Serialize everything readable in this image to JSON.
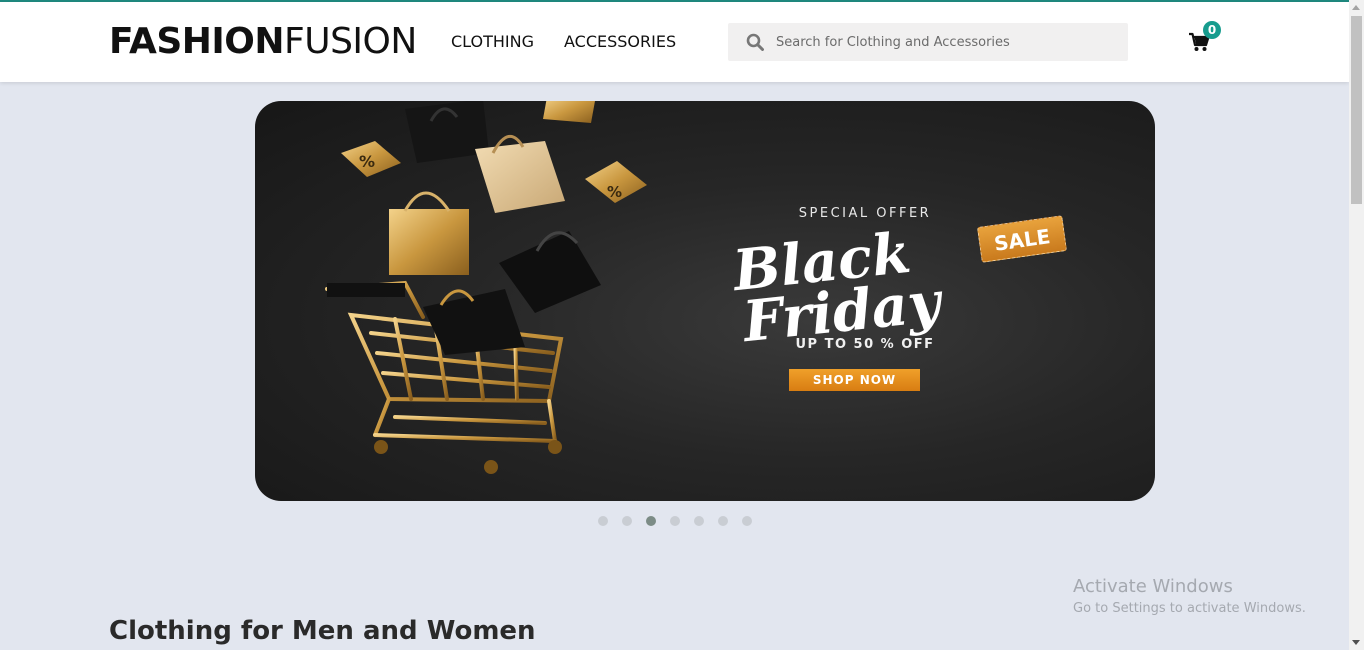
{
  "header": {
    "logo_bold": "FASHION",
    "logo_light": "FUSION",
    "nav": [
      {
        "label": "CLOTHING"
      },
      {
        "label": "ACCESSORIES"
      }
    ],
    "search_placeholder": "Search for Clothing and Accessories",
    "search_icon": "search-icon",
    "cart_icon": "cart-icon",
    "cart_count": "0"
  },
  "banner": {
    "special_offer": "SPECIAL OFFER",
    "title_line1": "Black",
    "title_line2": "Friday",
    "sale_tag": "SALE",
    "discount": "UP TO 50 % OFF",
    "cta": "SHOP NOW",
    "slide_count": 7,
    "active_slide": 3
  },
  "watermark": {
    "title": "Activate Windows",
    "subtitle": "Go to Settings to activate Windows."
  },
  "section": {
    "title": "Clothing for Men and Women"
  },
  "colors": {
    "accent": "#179c8e",
    "page_bg": "#e2e6ef",
    "banner_cta": "#e58e1b",
    "gold": "#c9a24a"
  }
}
